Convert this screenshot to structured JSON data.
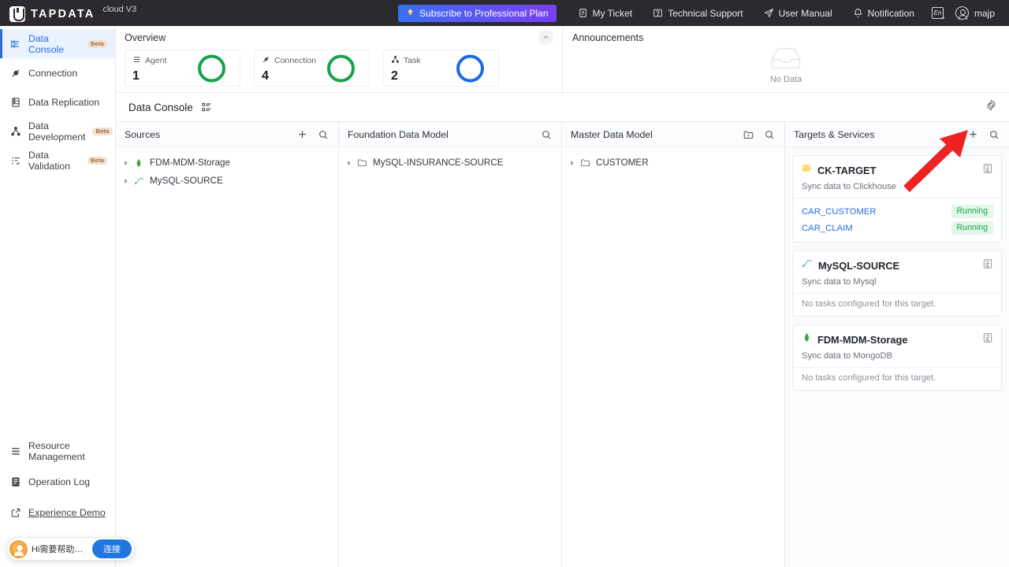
{
  "topbar": {
    "brand_name": "TAPDATA",
    "brand_sub": "cloud V3",
    "subscribe_label": "Subscribe to Professional Plan",
    "items": [
      {
        "label": "My Ticket",
        "icon": "ticket-icon"
      },
      {
        "label": "Technical Support",
        "icon": "support-icon"
      },
      {
        "label": "User Manual",
        "icon": "paper-plane-icon"
      },
      {
        "label": "Notification",
        "icon": "bell-icon"
      }
    ],
    "language": "En",
    "user": "majp",
    "accent_gradient_from": "#3a6ff0",
    "accent_gradient_to": "#7b3df0"
  },
  "sidebar": {
    "top_items": [
      {
        "label": "Data Console",
        "badge": "Beta",
        "icon": "console-icon",
        "active": true
      },
      {
        "label": "Connection",
        "badge": "",
        "icon": "plug-icon",
        "active": false
      },
      {
        "label": "Data Replication",
        "badge": "",
        "icon": "database-icon",
        "active": false
      },
      {
        "label": "Data Development",
        "badge": "Beta",
        "icon": "nodes-icon",
        "active": false
      },
      {
        "label": "Data Validation",
        "badge": "Beta",
        "icon": "checklist-icon",
        "active": false
      }
    ],
    "bottom_items": [
      {
        "label": "Resource Management",
        "icon": "layers-icon"
      },
      {
        "label": "Operation Log",
        "icon": "log-icon"
      },
      {
        "label": "Experience Demo",
        "icon": "external-link-icon"
      }
    ],
    "chat": {
      "text": "Hi需要帮助吗...",
      "button": "连接",
      "accent": "#2176e0"
    }
  },
  "overview": {
    "title": "Overview",
    "cards": [
      {
        "label": "Agent",
        "value": "1",
        "ring_color": "#16a34a",
        "icon": "agent-icon"
      },
      {
        "label": "Connection",
        "value": "4",
        "ring_color": "#16a34a",
        "icon": "plug-icon"
      },
      {
        "label": "Task",
        "value": "2",
        "ring_color": "#1d6ae5",
        "icon": "nodes-icon"
      }
    ]
  },
  "announcements": {
    "title": "Announcements",
    "empty_text": "No Data"
  },
  "console": {
    "title": "Data Console"
  },
  "columns": {
    "sources": {
      "title": "Sources",
      "items": [
        {
          "label": "FDM-MDM-Storage",
          "icon": "mongodb-icon"
        },
        {
          "label": "MySQL-SOURCE",
          "icon": "mysql-icon"
        }
      ]
    },
    "foundation": {
      "title": "Foundation Data Model",
      "items": [
        {
          "label": "MySQL-INSURANCE-SOURCE",
          "icon": "folder-icon"
        }
      ]
    },
    "master": {
      "title": "Master Data Model",
      "items": [
        {
          "label": "CUSTOMER",
          "icon": "folder-icon"
        }
      ]
    },
    "targets": {
      "title": "Targets & Services",
      "cards": [
        {
          "name": "CK-TARGET",
          "subtitle": "Sync data to Clickhouse",
          "icon": "clickhouse-icon",
          "empty_text": "",
          "tasks": [
            {
              "name": "CAR_CUSTOMER",
              "status": "Running"
            },
            {
              "name": "CAR_CLAIM",
              "status": "Running"
            }
          ]
        },
        {
          "name": "MySQL-SOURCE",
          "subtitle": "Sync data to Mysql",
          "icon": "mysql-icon",
          "empty_text": "No tasks configured for this target.",
          "tasks": []
        },
        {
          "name": "FDM-MDM-Storage",
          "subtitle": "Sync data to MongoDB",
          "icon": "mongodb-icon",
          "empty_text": "No tasks configured for this target.",
          "tasks": []
        }
      ]
    }
  },
  "annotation": {
    "arrow_color": "#ee2222",
    "points_to": "add-target-button"
  },
  "status_colors": {
    "running_bg": "#e3f8ea",
    "running_text": "#1a9e4b"
  }
}
